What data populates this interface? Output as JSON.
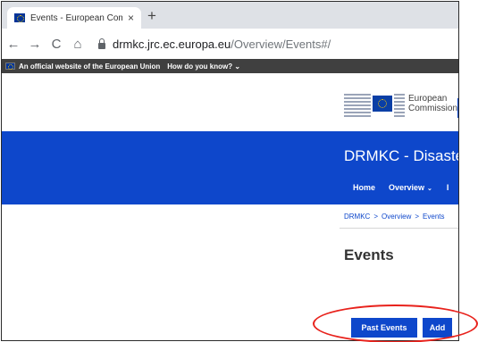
{
  "browser": {
    "tab_title": "Events - European Commission",
    "tab_close": "×",
    "new_tab": "+",
    "back": "←",
    "forward": "→",
    "reload": "C",
    "home": "⌂",
    "url_host": "drmkc.jrc.ec.europa.eu",
    "url_path": "/Overview/Events#/"
  },
  "eu_banner": {
    "official_text": "An official website of the European Union",
    "how_text": "How do you know? ⌄"
  },
  "header": {
    "logo_line1": "European",
    "logo_line2": "Commission",
    "site_title": "DRMKC - Disaste"
  },
  "nav": {
    "home": "Home",
    "overview": "Overview",
    "chevron": "⌄",
    "more": "I"
  },
  "breadcrumb": {
    "items": [
      "DRMKC",
      "Overview",
      "Events"
    ],
    "separator": ">"
  },
  "page": {
    "title": "Events"
  },
  "actions": {
    "past_events": "Past Events",
    "add": "Add"
  },
  "colors": {
    "eu_blue": "#0e47cb",
    "banner_gray": "#404040",
    "highlight_red": "#e8221c"
  }
}
